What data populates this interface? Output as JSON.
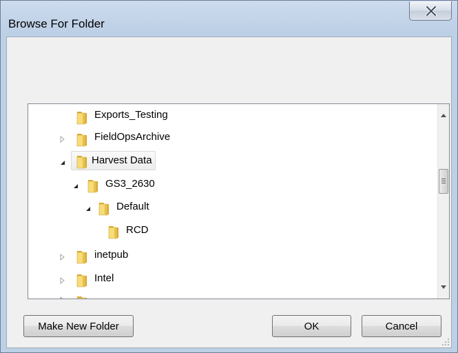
{
  "window": {
    "title": "Browse For Folder",
    "close_glyph": "X"
  },
  "tree": {
    "items": [
      {
        "label": "Exports_Testing",
        "expander": "none",
        "selected": false
      },
      {
        "label": "FieldOpsArchive",
        "expander": "collapsed",
        "selected": false
      },
      {
        "label": "Harvest Data",
        "expander": "expanded",
        "selected": true
      },
      {
        "label": "GS3_2630",
        "expander": "expanded",
        "selected": false
      },
      {
        "label": "Default",
        "expander": "expanded",
        "selected": false
      },
      {
        "label": "RCD",
        "expander": "none",
        "selected": false
      },
      {
        "label": "inetpub",
        "expander": "collapsed",
        "selected": false
      },
      {
        "label": "Intel",
        "expander": "collapsed",
        "selected": false
      }
    ]
  },
  "buttons": {
    "make_new_folder": "Make New Folder",
    "ok": "OK",
    "cancel": "Cancel"
  },
  "colors": {
    "title_bar": "#bfd1e7",
    "client_bg": "#f0f0f0",
    "folder_light": "#f8dc78",
    "folder_dark": "#d9a92c"
  }
}
